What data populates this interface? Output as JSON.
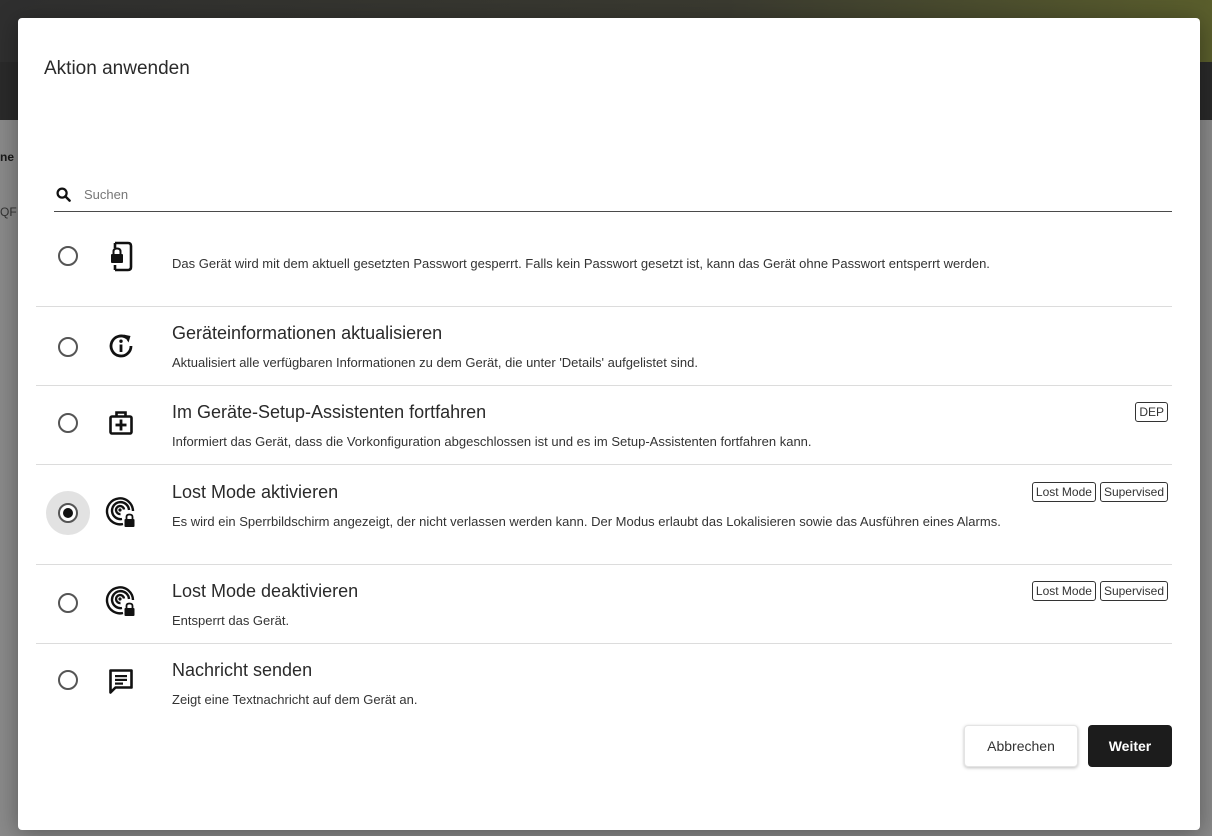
{
  "background": {
    "fragment_1": "ne",
    "fragment_2": "QF"
  },
  "modal": {
    "title": "Aktion anwenden",
    "search": {
      "placeholder": "Suchen",
      "value": ""
    },
    "actions": [
      {
        "title": "",
        "description": "Das Gerät wird mit dem aktuell gesetzten Passwort gesperrt. Falls kein Passwort gesetzt ist, kann das Gerät ohne Passwort entsperrt werden.",
        "icon": "phone-lock-icon",
        "selected": false,
        "badges": []
      },
      {
        "title": "Geräteinformationen aktualisieren",
        "description": "Aktualisiert alle verfügbaren Informationen zu dem Gerät, die unter 'Details' aufgelistet sind.",
        "icon": "info-refresh-icon",
        "selected": false,
        "badges": []
      },
      {
        "title": "Im Geräte-Setup-Assistenten fortfahren",
        "description": "Informiert das Gerät, dass die Vorkonfiguration abgeschlossen ist und es im Setup-Assistenten fortfahren kann.",
        "icon": "medical-bag-icon",
        "selected": false,
        "badges": [
          "DEP"
        ]
      },
      {
        "title": "Lost Mode aktivieren",
        "description": "Es wird ein Sperrbildschirm angezeigt, der nicht verlassen werden kann. Der Modus erlaubt das Lokalisieren sowie das Ausführen eines Alarms.",
        "icon": "radar-lock-icon",
        "selected": true,
        "badges": [
          "Lost Mode",
          "Supervised"
        ]
      },
      {
        "title": "Lost Mode deaktivieren",
        "description": "Entsperrt das Gerät.",
        "icon": "radar-lock-icon",
        "selected": false,
        "badges": [
          "Lost Mode",
          "Supervised"
        ]
      },
      {
        "title": "Nachricht senden",
        "description": "Zeigt eine Textnachricht auf dem Gerät an.",
        "icon": "message-icon",
        "selected": false,
        "badges": []
      }
    ],
    "buttons": {
      "cancel": "Abbrechen",
      "next": "Weiter"
    }
  }
}
